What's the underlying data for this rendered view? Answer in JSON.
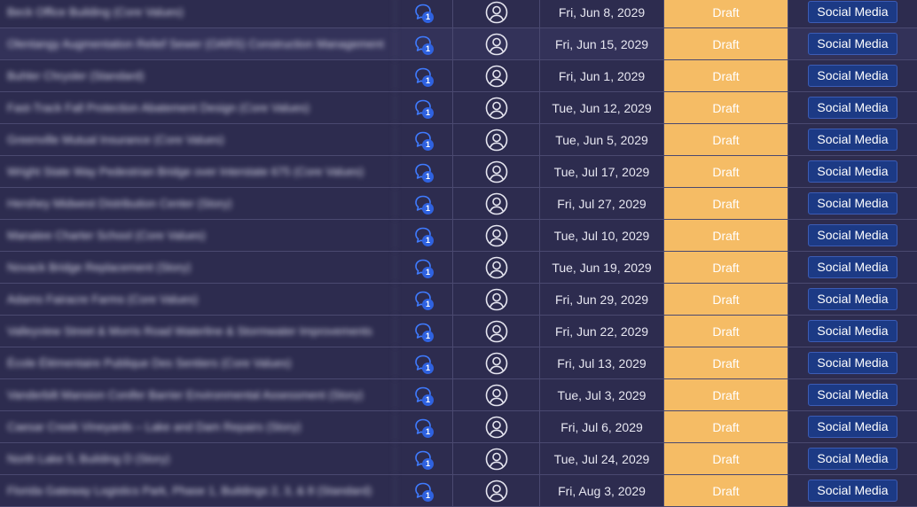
{
  "rows": [
    {
      "name": "Beck Office Building (Core Values)",
      "comments": "1",
      "date": "Fri, Jun 8, 2029",
      "status": "Draft",
      "channel": "Social Media"
    },
    {
      "name": "Olentangy Augmentation Relief Sewer (OARS) Construction Management",
      "comments": "1",
      "date": "Fri, Jun 15, 2029",
      "status": "Draft",
      "channel": "Social Media"
    },
    {
      "name": "Buhler Chrysler (Standard)",
      "comments": "1",
      "date": "Fri, Jun 1, 2029",
      "status": "Draft",
      "channel": "Social Media"
    },
    {
      "name": "Fast-Track Fall Protection Abatement Design (Core Values)",
      "comments": "1",
      "date": "Tue, Jun 12, 2029",
      "status": "Draft",
      "channel": "Social Media"
    },
    {
      "name": "Greenville Mutual Insurance (Core Values)",
      "comments": "1",
      "date": "Tue, Jun 5, 2029",
      "status": "Draft",
      "channel": "Social Media"
    },
    {
      "name": "Wright State Way Pedestrian Bridge over Interstate 675 (Core Values)",
      "comments": "1",
      "date": "Tue, Jul 17, 2029",
      "status": "Draft",
      "channel": "Social Media"
    },
    {
      "name": "Hershey Midwest Distribution Center (Story)",
      "comments": "1",
      "date": "Fri, Jul 27, 2029",
      "status": "Draft",
      "channel": "Social Media"
    },
    {
      "name": "Manatee Charter School (Core Values)",
      "comments": "1",
      "date": "Tue, Jul 10, 2029",
      "status": "Draft",
      "channel": "Social Media"
    },
    {
      "name": "Novack Bridge Replacement (Story)",
      "comments": "1",
      "date": "Tue, Jun 19, 2029",
      "status": "Draft",
      "channel": "Social Media"
    },
    {
      "name": "Adams Fairacre Farms (Core Values)",
      "comments": "1",
      "date": "Fri, Jun 29, 2029",
      "status": "Draft",
      "channel": "Social Media"
    },
    {
      "name": "Valleyview Street & Morris Road Waterline & Stormwater Improvements",
      "comments": "1",
      "date": "Fri, Jun 22, 2029",
      "status": "Draft",
      "channel": "Social Media"
    },
    {
      "name": "École Élémentaire Publique Des Sentiers (Core Values)",
      "comments": "1",
      "date": "Fri, Jul 13, 2029",
      "status": "Draft",
      "channel": "Social Media"
    },
    {
      "name": "Vanderbilt Mansion Conifer Barrier Environmental Assessment (Story)",
      "comments": "1",
      "date": "Tue, Jul 3, 2029",
      "status": "Draft",
      "channel": "Social Media"
    },
    {
      "name": "Caesar Creek Vineyards – Lake and Dam Repairs (Story)",
      "comments": "1",
      "date": "Fri, Jul 6, 2029",
      "status": "Draft",
      "channel": "Social Media"
    },
    {
      "name": "North Lake 5, Building D (Story)",
      "comments": "1",
      "date": "Tue, Jul 24, 2029",
      "status": "Draft",
      "channel": "Social Media"
    },
    {
      "name": "Florida Gateway Logistics Park, Phase 1, Buildings 2, 3, & 8 (Standard)",
      "comments": "1",
      "date": "Fri, Aug 3, 2029",
      "status": "Draft",
      "channel": "Social Media"
    }
  ],
  "colors": {
    "background": "#2d2c4f",
    "status_draft": "#f5bc65",
    "channel_button": "#1c3a85",
    "comment_icon": "#3f7bff"
  },
  "icons": {
    "comment": "comment-bubble-icon",
    "user": "user-avatar-icon"
  }
}
